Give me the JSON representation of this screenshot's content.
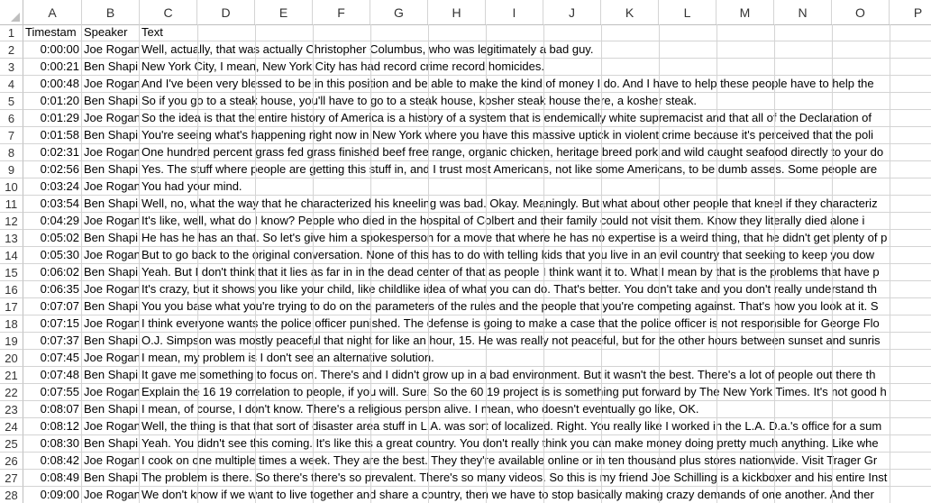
{
  "columns": [
    "A",
    "B",
    "C",
    "D",
    "E",
    "F",
    "G",
    "H",
    "I",
    "J",
    "K",
    "L",
    "M",
    "N",
    "O",
    "P"
  ],
  "header": {
    "row": "1",
    "a": "Timestam",
    "b": "Speaker",
    "c": "Text"
  },
  "rows": [
    {
      "n": "2",
      "t": "0:00:00",
      "s": "Joe Rogan",
      "x": "Well, actually, that was actually Christopher Columbus, who was legitimately a bad guy."
    },
    {
      "n": "3",
      "t": "0:00:21",
      "s": "Ben Shapi",
      "x": "New York City, I mean, New York City has had record crime record homicides."
    },
    {
      "n": "4",
      "t": "0:00:48",
      "s": "Joe Rogan",
      "x": "And I've been very blessed to be in this position and be able to make the kind of money I do. And I have to help these people have to help the"
    },
    {
      "n": "5",
      "t": "0:01:20",
      "s": "Ben Shapi",
      "x": "So if you go to a steak house, you'll have to go to a steak house, kosher steak house there, a kosher steak."
    },
    {
      "n": "6",
      "t": "0:01:29",
      "s": "Joe Rogan",
      "x": "So the idea is that the entire history of America is a history of a system that is endemically white supremacist and that all of the Declaration of"
    },
    {
      "n": "7",
      "t": "0:01:58",
      "s": "Ben Shapi",
      "x": "You're seeing what's happening right now in New York where you have this massive uptick in violent crime because it's perceived that the poli"
    },
    {
      "n": "8",
      "t": "0:02:31",
      "s": "Joe Rogan",
      "x": "One hundred percent grass fed grass finished beef free range, organic chicken, heritage breed pork and wild caught seafood directly to your do"
    },
    {
      "n": "9",
      "t": "0:02:56",
      "s": "Ben Shapi",
      "x": "Yes. The stuff where people are getting this stuff in, and I trust most Americans, not like some Americans, to be dumb asses. Some people are"
    },
    {
      "n": "10",
      "t": "0:03:24",
      "s": "Joe Rogan",
      "x": "You had your mind."
    },
    {
      "n": "11",
      "t": "0:03:54",
      "s": "Ben Shapi",
      "x": "Well, no, what the way that he characterized his kneeling was bad. Okay. Meaningly. But what about other people that kneel if they characteriz"
    },
    {
      "n": "12",
      "t": "0:04:29",
      "s": "Joe Rogan",
      "x": "It's like, well, what do I know? People who died in the hospital of Colbert and their family could not visit them. Know they literally died alone i"
    },
    {
      "n": "13",
      "t": "0:05:02",
      "s": "Ben Shapi",
      "x": "He has he has an that. So let's give him a spokesperson for a move that where he has no expertise is a weird thing, that he didn't get plenty of p"
    },
    {
      "n": "14",
      "t": "0:05:30",
      "s": "Joe Rogan",
      "x": "But to go back to the original conversation. None of this has to do with telling kids that you live in an evil country that seeking to keep you dow"
    },
    {
      "n": "15",
      "t": "0:06:02",
      "s": "Ben Shapi",
      "x": "Yeah. But I don't think that it lies as far in in the dead center of that as people I think want it to. What I mean by that is the problems that have p"
    },
    {
      "n": "16",
      "t": "0:06:35",
      "s": "Joe Rogan",
      "x": "It's crazy, but it shows you like your child, like childlike idea of what you can do. That's better. You don't take and you don't really understand th"
    },
    {
      "n": "17",
      "t": "0:07:07",
      "s": "Ben Shapi",
      "x": "You you base what you're trying to do on the parameters of the rules and the people that you're competing against. That's how you look at it. S"
    },
    {
      "n": "18",
      "t": "0:07:15",
      "s": "Joe Rogan",
      "x": "I think everyone wants the police officer punished. The defense is going to make a case that the police officer is not responsible for George Flo"
    },
    {
      "n": "19",
      "t": "0:07:37",
      "s": "Ben Shapi",
      "x": "O.J. Simpson was mostly peaceful that night for like an hour, 15. He was really not peaceful, but for the other hours between sunset and sunris"
    },
    {
      "n": "20",
      "t": "0:07:45",
      "s": "Joe Rogan",
      "x": "I mean, my problem is I don't see an alternative solution."
    },
    {
      "n": "21",
      "t": "0:07:48",
      "s": "Ben Shapi",
      "x": "It gave me something to focus on. There's and I didn't grow up in a bad environment. But it wasn't the best. There's a lot of people out there th"
    },
    {
      "n": "22",
      "t": "0:07:55",
      "s": "Joe Rogan",
      "x": "Explain the 16 19 correlation to people, if you will. Sure. So the 60 19 project is is something put forward by The New York Times. It's not good h"
    },
    {
      "n": "23",
      "t": "0:08:07",
      "s": "Ben Shapi",
      "x": "I mean, of course, I don't know. There's a religious person alive. I mean, who doesn't eventually go like, OK."
    },
    {
      "n": "24",
      "t": "0:08:12",
      "s": "Joe Rogan",
      "x": "Well, the thing is that that sort of disaster area stuff in L.A. was sort of localized. Right. You really like I worked in the L.A. D.a.'s office for a sum"
    },
    {
      "n": "25",
      "t": "0:08:30",
      "s": "Ben Shapi",
      "x": "Yeah. You didn't see this coming. It's like this a great country. You don't really think you can make money doing pretty much anything. Like whe"
    },
    {
      "n": "26",
      "t": "0:08:42",
      "s": "Joe Rogan",
      "x": "I cook on one multiple times a week. They are the best. They they're available online or in ten thousand plus stores nationwide. Visit Trager Gr"
    },
    {
      "n": "27",
      "t": "0:08:49",
      "s": "Ben Shapi",
      "x": "The problem is there. So there's there's so prevalent. There's so many videos. So this is my friend Joe Schilling is a kickboxer and his entire Inst"
    },
    {
      "n": "28",
      "t": "0:09:00",
      "s": "Joe Rogan",
      "x": "We don't know if we want to live together and share a country, then we have to stop basically making crazy demands of one another. And ther"
    }
  ]
}
